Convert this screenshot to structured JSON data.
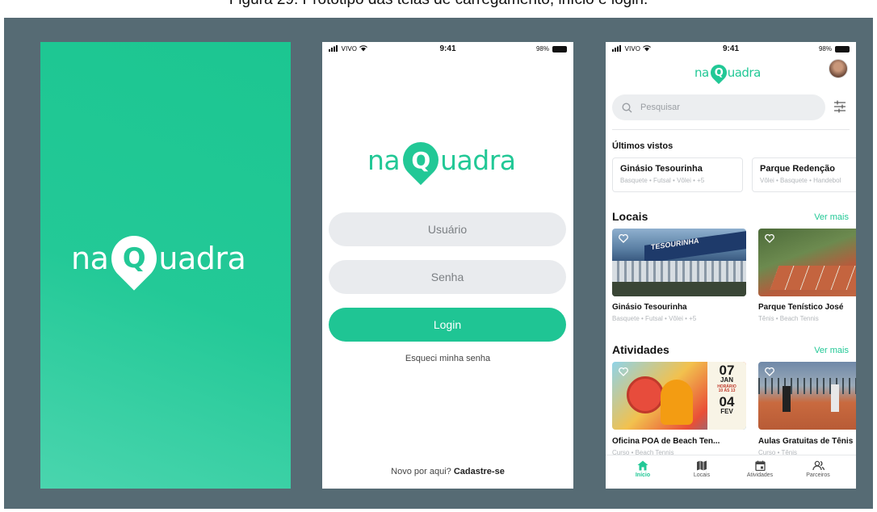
{
  "caption": "Figura 29: Protótipo das telas de carregamento, início e login.",
  "brand": {
    "name_left": "na",
    "name_pin": "Q",
    "name_right": "uadra",
    "primary_color": "#22c896",
    "backdrop_color": "#566b74"
  },
  "status_bar": {
    "carrier": "VIVO",
    "time": "9:41",
    "battery": "98%"
  },
  "login": {
    "username_placeholder": "Usuário",
    "password_placeholder": "Senha",
    "login_label": "Login",
    "forgot_label": "Esqueci minha senha",
    "signup_prefix": "Novo por aqui?",
    "signup_link": "Cadastre-se"
  },
  "home": {
    "search_placeholder": "Pesquisar",
    "recent_title": "Últimos vistos",
    "recent_items": [
      {
        "name": "Ginásio Tesourinha",
        "sports": "Basquete • Futsal • Vôlei • +5"
      },
      {
        "name": "Parque Redenção",
        "sports": "Vôlei • Basquete • Handebol"
      }
    ],
    "places_title": "Locais",
    "see_more": "Ver mais",
    "places": [
      {
        "name": "Ginásio Tesourinha",
        "sports": "Basquete • Futsal • Vôlei • +5",
        "sign_text": "TESOURINHA"
      },
      {
        "name": "Parque Tenístico José",
        "sports": "Tênis • Beach Tennis"
      }
    ],
    "activities_title": "Atividades",
    "activities": [
      {
        "name": "Oficina POA de Beach Ten...",
        "sub": "Curso • Beach Tennis",
        "poster_day1": "07",
        "poster_month1": "JAN",
        "poster_time1": "HORÁRIO",
        "poster_time2": "10 ÀS 13",
        "poster_day2": "04",
        "poster_month2": "FEV"
      },
      {
        "name": "Aulas Gratuitas de Tênis",
        "sub": "Curso • Tênis"
      }
    ],
    "tabs": [
      {
        "label": "Início",
        "icon": "home-icon",
        "active": true
      },
      {
        "label": "Locais",
        "icon": "map-icon",
        "active": false
      },
      {
        "label": "Atividades",
        "icon": "calendar-icon",
        "active": false
      },
      {
        "label": "Parceiros",
        "icon": "people-icon",
        "active": false
      }
    ]
  }
}
